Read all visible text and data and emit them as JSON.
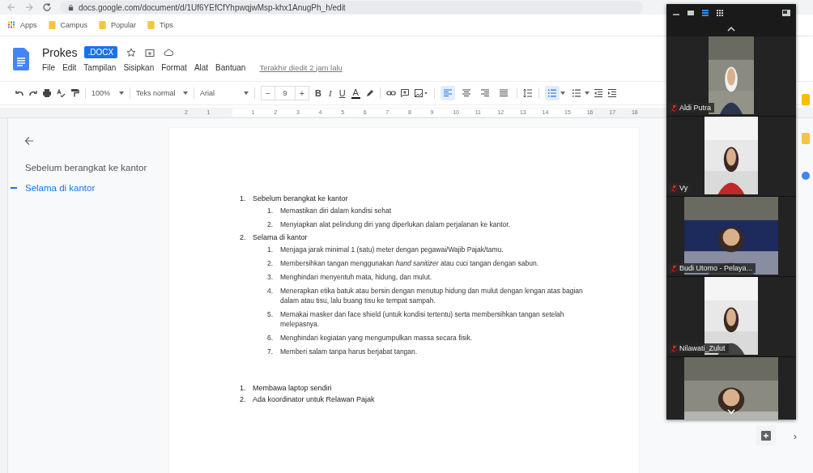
{
  "browser": {
    "url": "docs.google.com/document/d/1Uf6YEfCfYhpwqjwMsp-khx1AnugPh_h/edit",
    "bookmarks": [
      {
        "label": "Apps",
        "kind": "apps"
      },
      {
        "label": "Campus",
        "kind": "folder"
      },
      {
        "label": "Popular",
        "kind": "folder"
      },
      {
        "label": "Tips",
        "kind": "folder"
      }
    ]
  },
  "doc": {
    "title": "Prokes",
    "badge": ".DOCX",
    "menu": [
      "File",
      "Edit",
      "Tampilan",
      "Sisipkan",
      "Format",
      "Alat",
      "Bantuan"
    ],
    "last_edit": "Terakhir diedit 2 jam lalu"
  },
  "toolbar": {
    "zoom": "100%",
    "style": "Teks normal",
    "font": "Arial",
    "size_minus": "−",
    "font_size": "9",
    "size_plus": "+",
    "format_buttons": [
      {
        "label": "B",
        "kind": "bold"
      },
      {
        "label": "I",
        "kind": "italic"
      },
      {
        "label": "U",
        "kind": "underline"
      },
      {
        "label": "A",
        "kind": "color"
      }
    ],
    "align": [
      {
        "kind": "left",
        "selected": true
      },
      {
        "kind": "center",
        "selected": false
      },
      {
        "kind": "right",
        "selected": false
      },
      {
        "kind": "justify",
        "selected": false
      }
    ],
    "lists": [
      {
        "kind": "numbered",
        "selected": true
      },
      {
        "kind": "bulleted",
        "selected": false
      }
    ]
  },
  "ruler": {
    "labels": [
      "2",
      "1",
      "1",
      "2",
      "3",
      "4",
      "5",
      "6",
      "7",
      "8",
      "9",
      "10",
      "11",
      "12",
      "13",
      "14",
      "15",
      "16",
      "17",
      "18"
    ]
  },
  "outline": {
    "items": [
      {
        "label": "Sebelum berangkat ke kantor",
        "selected": false
      },
      {
        "label": "Selama di kantor",
        "selected": true
      }
    ]
  },
  "document": {
    "lists": [
      {
        "items": [
          {
            "number": "1.",
            "text": "Sebelum berangkat ke kantor",
            "children": [
              {
                "number": "1.",
                "text": "Memastikan diri dalam kondisi sehat"
              },
              {
                "number": "2.",
                "text": "Menyiapkan alat pelindung diri yang diperlukan dalam perjalanan ke kantor."
              }
            ]
          },
          {
            "number": "2.",
            "text": "Selama di kantor",
            "children": [
              {
                "number": "1.",
                "text": "Menjaga jarak minimal 1 (satu) meter dengan pegawai/Wajib Pajak/tamu."
              },
              {
                "number": "2.",
                "text": "Membersihkan tangan menggunakan *hand sanitizer* atau cuci tangan dengan sabun."
              },
              {
                "number": "3.",
                "text": "Menghindari menyentuh mata, hidung, dan mulut."
              },
              {
                "number": "4.",
                "text": "Menerapkan etika batuk atau bersin dengan menutup hidung dan mulut dengan lengan atas bagian dalam atau tisu, lalu buang tisu ke tempat sampah."
              },
              {
                "number": "5.",
                "text": "Memakai masker dan face shield (untuk kondisi tertentu) serta membersihkan tangan setelah melepasnya."
              },
              {
                "number": "6.",
                "text": "Menghindari kegiatan yang mengumpulkan massa secara fisik."
              },
              {
                "number": "7.",
                "text": "Memberi salam tanpa harus berjabat tangan."
              }
            ]
          }
        ]
      },
      {
        "items": [
          {
            "number": "1.",
            "text": "Membawa laptop sendiri"
          },
          {
            "number": "2.",
            "text": "Ada koordinator untuk Relawan Pajak"
          }
        ]
      }
    ]
  },
  "meeting": {
    "participants": [
      {
        "name": "Aldi Putra",
        "muted": true,
        "kind": "narrow"
      },
      {
        "name": "Vy",
        "muted": true,
        "kind": "portrait"
      },
      {
        "name": "Budi Utomo - Pelaya...",
        "muted": true,
        "kind": "wide"
      },
      {
        "name": "Nilawati_Zulut",
        "muted": true,
        "kind": "portrait"
      },
      {
        "kind": "wide"
      }
    ]
  },
  "side_panel": {
    "toggle": "›"
  }
}
